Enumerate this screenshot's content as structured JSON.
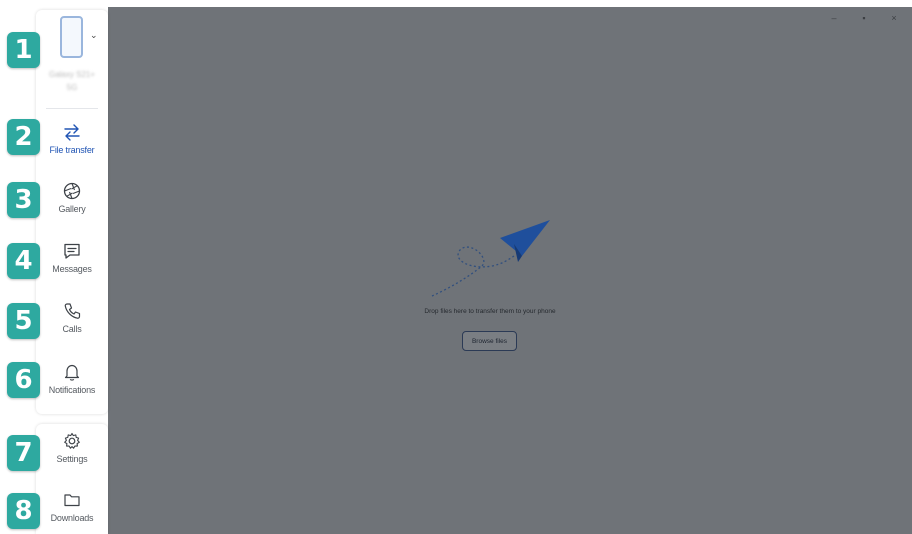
{
  "window": {
    "controls": [
      "–",
      "▪",
      "×"
    ]
  },
  "device": {
    "name": "Galaxy S21+ 5G",
    "chevron": "⌄"
  },
  "nav": {
    "file_transfer": "File transfer",
    "gallery": "Gallery",
    "messages": "Messages",
    "calls": "Calls",
    "notifications": "Notifications",
    "settings": "Settings",
    "downloads": "Downloads"
  },
  "badges": [
    "1",
    "2",
    "3",
    "4",
    "5",
    "6",
    "7",
    "8"
  ],
  "main": {
    "drop_text": "Drop files here to transfer them to your phone",
    "browse_label": "Browse files"
  },
  "colors": {
    "badge": "#2ea9a0",
    "active": "#2155b4",
    "overlay": "#6f7378",
    "plane": "#1f4f9c"
  },
  "icons": [
    "phone-icon",
    "transfer-arrows-icon",
    "gallery-aperture-icon",
    "message-icon",
    "phone-call-icon",
    "bell-icon",
    "gear-icon",
    "folder-icon",
    "paper-plane-icon"
  ]
}
